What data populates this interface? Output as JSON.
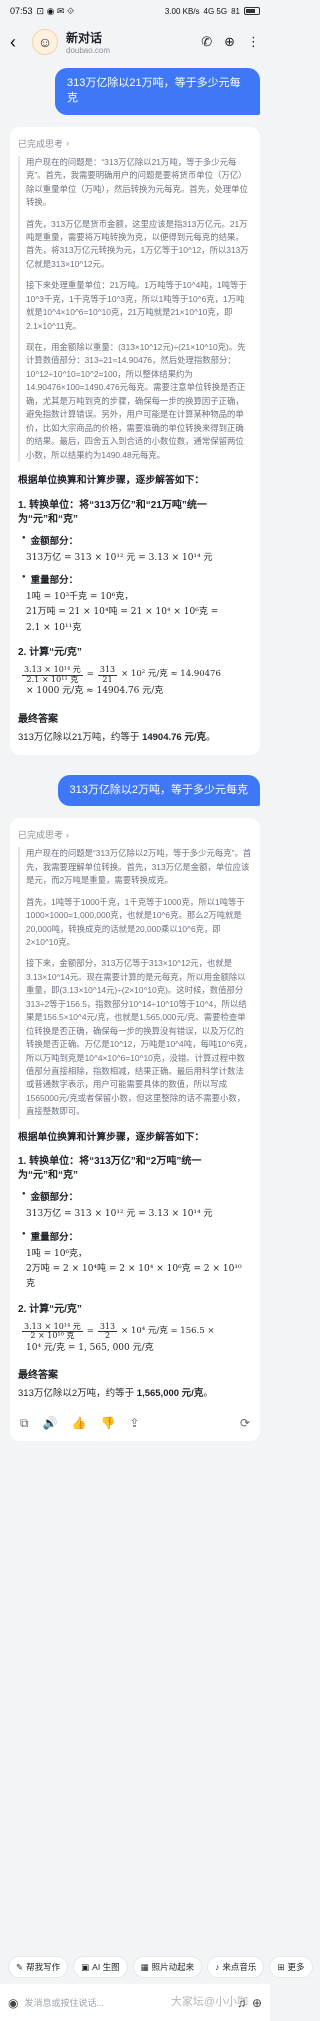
{
  "status": {
    "time": "07:53",
    "icons_left": "⊡ ◉ ✉ ⟐",
    "network": "3.00 KB/s",
    "signal": "4G 5G",
    "battery": "81"
  },
  "header": {
    "title": "新对话",
    "subtitle": "doubao.com",
    "avatar_icon": "doubao-avatar-icon"
  },
  "messages": [
    {
      "question": "313万亿除以21万吨，等于多少元每克",
      "think_label": "已完成思考",
      "think": [
        "用户现在的问题是：“313万亿除以21万吨，等于多少元每克”。首先，我需要明确用户的问题是要将货币单位（万亿）除以重量单位（万吨），然后转换为元每克。首先，处理单位转换。",
        "首先，313万亿是货币金额，这里应该是指313万亿元。21万吨是重量，需要将万吨转换为克，以便得到元每克的结果。首先，将313万亿元转换为元，1万亿等于10^12，所以313万亿就是313×10^12元。",
        "接下来处理重量单位：21万吨。1万吨等于10^4吨，1吨等于10^3千克，1千克等于10^3克，所以1吨等于10^6克，1万吨就是10^4×10^6=10^10克，21万吨就是21×10^10克，即2.1×10^11克。",
        "现在，用金额除以重量：(313×10^12元)÷(21×10^10克)。先计算数值部分：313÷21≈14.90476，然后处理指数部分：10^12÷10^10=10^2=100，所以整体结果约为14.90476×100=1490.476元每克。需要注意单位转换是否正确，尤其是万吨到克的步骤，确保每一步的换算因子正确，避免指数计算错误。另外，用户可能是在计算某种物品的单价，比如大宗商品的价格，需要准确的单位转换来得到正确的结果。最后，四舍五入到合适的小数位数，通常保留两位小数，所以结果约为1490.48元每克。"
      ],
      "lead": "根据单位换算和计算步骤，逐步解答如下：",
      "step1_title": "1. 转换单位：将“313万亿”和“21万吨”统一为“元”和“克”",
      "amount_label": "金额部分：",
      "amount_formula": "313万亿 = 313 × 10¹² 元 = 3.13 × 10¹⁴ 元",
      "weight_label": "重量部分：",
      "weight_formula_1": "1吨 = 10³千克 = 10⁶克，",
      "weight_formula_2": "21万吨 = 21 × 10⁴吨 = 21 × 10⁴ × 10⁶克 =",
      "weight_formula_3": "2.1 × 10¹¹克",
      "step2_title": "2. 计算“元/克”",
      "calc_num": "3.13 × 10¹⁴ 元",
      "calc_den": "2.1 × 10¹¹ 克",
      "calc_mid_num": "313",
      "calc_mid_den": "21",
      "calc_rest": "× 10² 元/克 ≈ 14.90476",
      "calc_line2": "× 1000 元/克 ≈ 14904.76 元/克",
      "final_title": "最终答案",
      "final_pre": "313万亿除以21万吨，约等于 ",
      "final_value": "14904.76 元/克",
      "final_post": "。"
    },
    {
      "question": "313万亿除以2万吨，等于多少元每克",
      "think_label": "已完成思考",
      "think": [
        "用户现在的问题是“313万亿除以2万吨，等于多少元每克”。首先，我需要理解单位转换。首先，313万亿是金额，单位应该是元，而2万吨是重量，需要转换成克。",
        "首先，1吨等于1000千克，1千克等于1000克，所以1吨等于1000×1000=1,000,000克，也就是10^6克。那么2万吨就是20,000吨，转换成克的话就是20,000乘以10^6克，即2×10^10克。",
        "接下来，金额部分，313万亿等于313×10^12元，也就是3.13×10^14元。现在需要计算的是元每克，所以用金额除以重量，即(3.13×10^14元)÷(2×10^10克)。这时候，数值部分313÷2等于156.5，指数部分10^14÷10^10等于10^4，所以结果是156.5×10^4元/克，也就是1,565,000元/克。需要检查单位转换是否正确，确保每一步的换算没有错误，以及万亿的转换是否正确。万亿是10^12，万吨是10^4吨，每吨10^6克，所以万吨到克是10^4×10^6=10^10克，没错。计算过程中数值部分直接相除，指数相减，结果正确。最后用科学计数法或普通数字表示，用户可能需要具体的数值，所以写成1565000元/克或者保留小数，但这里整除的话不需要小数，直接整数即可。"
      ],
      "lead": "根据单位换算和计算步骤，逐步解答如下：",
      "step1_title": "1. 转换单位：将“313万亿”和“2万吨”统一为“元”和“克”",
      "amount_label": "金额部分：",
      "amount_formula": "313万亿 = 313 × 10¹² 元 = 3.13 × 10¹⁴ 元",
      "weight_label": "重量部分：",
      "weight_formula_1": "1吨 = 10⁶克，",
      "weight_formula_2": "2万吨 = 2 × 10⁴吨 = 2 × 10⁴ × 10⁶克 = 2 × 10¹⁰ 克",
      "weight_formula_3": "",
      "step2_title": "2. 计算“元/克”",
      "calc_num": "3.13 × 10¹⁴ 元",
      "calc_den": "2 × 10¹⁰ 克",
      "calc_mid_num": "313",
      "calc_mid_den": "2",
      "calc_rest": "× 10⁴ 元/克 = 156.5 ×",
      "calc_line2": "10⁴ 元/克 = 1, 565, 000 元/克",
      "final_title": "最终答案",
      "final_pre": "313万亿除以2万吨，约等于 ",
      "final_value": "1,565,000 元/克",
      "final_post": "。"
    }
  ],
  "actions": {
    "copy": "⧉",
    "speak": "🔊",
    "like": "👍",
    "dislike": "👎",
    "share": "⇪",
    "refresh": "⟳"
  },
  "chips": [
    {
      "icon": "✎",
      "label": "帮我写作"
    },
    {
      "icon": "▣",
      "label": "AI 生图"
    },
    {
      "icon": "▦",
      "label": "照片动起来"
    },
    {
      "icon": "♪",
      "label": "来点音乐"
    },
    {
      "icon": "⊞",
      "label": "更多"
    }
  ],
  "input": {
    "placeholder": "发消息或按住说话...",
    "watermark": "大家坛@小小咖"
  }
}
